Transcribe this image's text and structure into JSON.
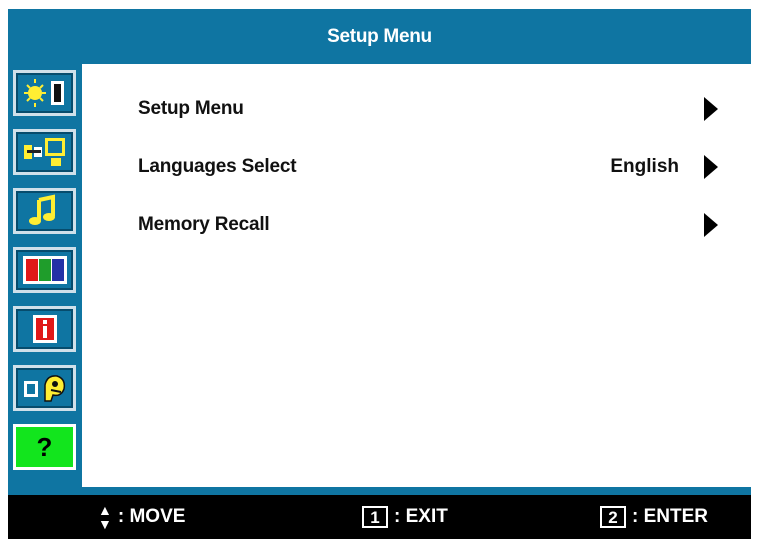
{
  "window": {
    "title": "Setup Menu"
  },
  "sidebar": {
    "items": [
      {
        "icon": "brightness-contrast-icon",
        "active": false
      },
      {
        "icon": "input-select-icon",
        "active": false
      },
      {
        "icon": "audio-adjust-icon",
        "active": false
      },
      {
        "icon": "color-adjust-icon",
        "active": false
      },
      {
        "icon": "information-icon",
        "active": false
      },
      {
        "icon": "manual-image-adjust-icon",
        "active": false
      },
      {
        "icon": "setup-menu-icon",
        "active": true,
        "glyph": "?"
      }
    ]
  },
  "menu": {
    "items": [
      {
        "label": "Setup Menu",
        "value": ""
      },
      {
        "label": "Languages Select",
        "value": "English"
      },
      {
        "label": "Memory Recall",
        "value": ""
      }
    ]
  },
  "footer": {
    "move_label": ": MOVE",
    "exit_key": "1",
    "exit_label": ": EXIT",
    "enter_key": "2",
    "enter_label": ": ENTER"
  },
  "colors": {
    "title_bar": "#0f75a2",
    "sidebar_active": "#12e51d",
    "footer_bg": "#000000"
  }
}
